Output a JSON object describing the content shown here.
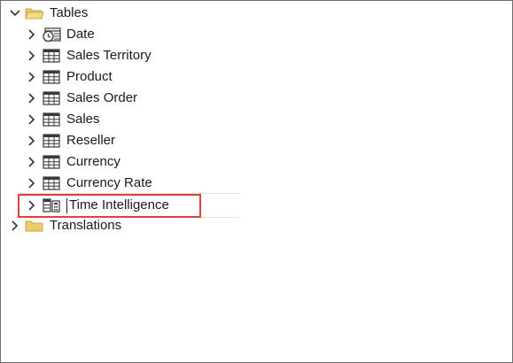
{
  "tree": {
    "root": {
      "label": "Tables",
      "expanded": true,
      "icon": "folder-open-icon",
      "children": [
        {
          "label": "Date",
          "icon": "date-table-icon",
          "expanded": false
        },
        {
          "label": "Sales Territory",
          "icon": "table-icon",
          "expanded": false
        },
        {
          "label": "Product",
          "icon": "table-icon",
          "expanded": false
        },
        {
          "label": "Sales Order",
          "icon": "table-icon",
          "expanded": false
        },
        {
          "label": "Sales",
          "icon": "table-icon",
          "expanded": false
        },
        {
          "label": "Reseller",
          "icon": "table-icon",
          "expanded": false
        },
        {
          "label": "Currency",
          "icon": "table-icon",
          "expanded": false
        },
        {
          "label": "Currency Rate",
          "icon": "table-icon",
          "expanded": false
        },
        {
          "label": "Time Intelligence",
          "icon": "calculation-group-icon",
          "expanded": false,
          "selected": true,
          "highlighted": true
        }
      ]
    },
    "sibling": {
      "label": "Translations",
      "icon": "folder-icon",
      "expanded": false
    }
  },
  "colors": {
    "folder": "#e8cd6a",
    "highlight_border": "#e0413d",
    "icon_stroke": "#3a3a3a",
    "frame_border": "#6e6e6e"
  }
}
